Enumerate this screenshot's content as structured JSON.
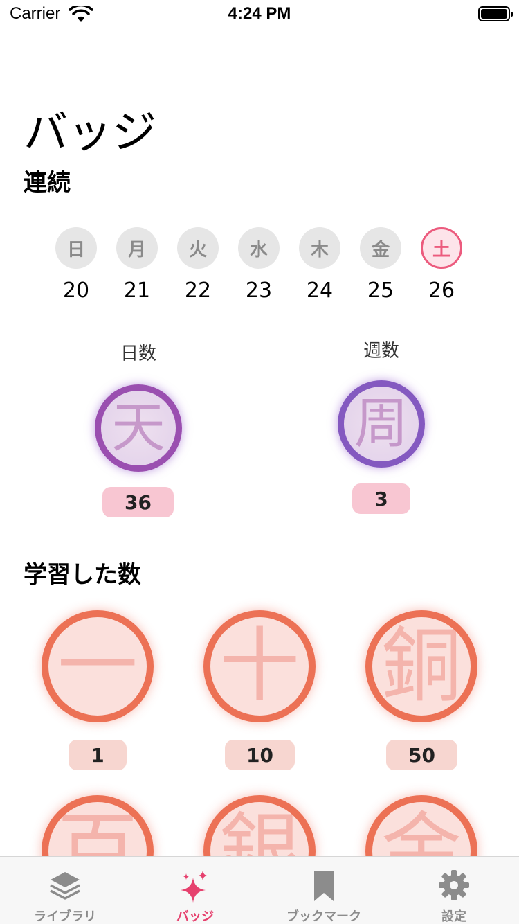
{
  "status_bar": {
    "carrier": "Carrier",
    "time": "4:24 PM"
  },
  "page_title": "バッジ",
  "streak": {
    "section_title": "連続",
    "days": [
      {
        "weekday": "日",
        "date": "20",
        "active": false
      },
      {
        "weekday": "月",
        "date": "21",
        "active": false
      },
      {
        "weekday": "火",
        "date": "22",
        "active": false
      },
      {
        "weekday": "水",
        "date": "23",
        "active": false
      },
      {
        "weekday": "木",
        "date": "24",
        "active": false
      },
      {
        "weekday": "金",
        "date": "25",
        "active": false
      },
      {
        "weekday": "土",
        "date": "26",
        "active": true
      }
    ],
    "badges": [
      {
        "label": "日数",
        "glyph": "天",
        "count": "36"
      },
      {
        "label": "週数",
        "glyph": "周",
        "count": "3"
      }
    ]
  },
  "learned": {
    "section_title": "学習した数",
    "badges": [
      {
        "glyph": "一",
        "count": "1"
      },
      {
        "glyph": "十",
        "count": "10"
      },
      {
        "glyph": "銅",
        "count": "50"
      },
      {
        "glyph": "百"
      },
      {
        "glyph": "銀"
      },
      {
        "glyph": "金"
      }
    ]
  },
  "tabs": [
    {
      "label": "ライブラリ",
      "icon": "stack-icon",
      "active": false
    },
    {
      "label": "バッジ",
      "icon": "sparkles-icon",
      "active": true
    },
    {
      "label": "ブックマーク",
      "icon": "bookmark-icon",
      "active": false
    },
    {
      "label": "設定",
      "icon": "gear-icon",
      "active": false
    }
  ],
  "colors": {
    "accent": "#e6416e",
    "inactive": "#8c8c8c",
    "purple": "#9a4fb0",
    "orange": "#ec7155",
    "today": "#ec5b7e"
  }
}
